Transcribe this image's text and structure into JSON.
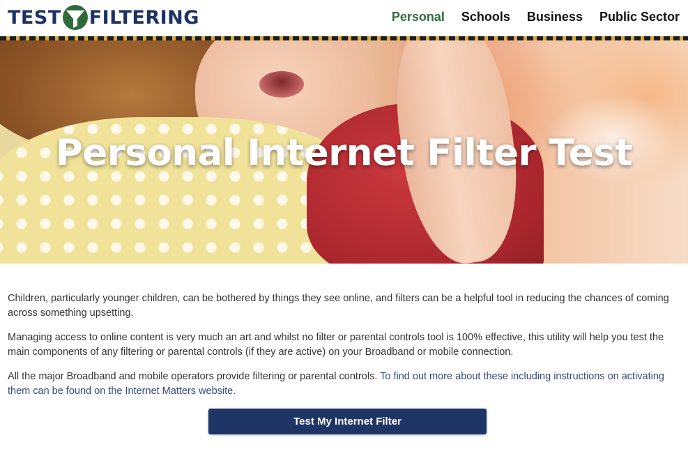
{
  "brand": {
    "logo_left": "TEST",
    "logo_right": "FILTERING",
    "logo_icon": "funnel-icon",
    "navy": "#1d3264",
    "green": "#2f6b3a"
  },
  "nav": {
    "items": [
      {
        "label": "Personal",
        "active": true
      },
      {
        "label": "Schools"
      },
      {
        "label": "Business"
      },
      {
        "label": "Public Sector"
      }
    ]
  },
  "hero": {
    "title": "Personal Internet Filter Test"
  },
  "content": {
    "p1": "Children, particularly younger children, can be bothered by things they see online, and filters can be a helpful tool in reducing the chances of coming across something upsetting.",
    "p2": "Managing access to online content is very much an art and whilst no filter or parental controls tool is 100% effective, this utility will help you test the main components of any filtering or parental controls (if they are active) on your Broadband or mobile connection.",
    "p3_text": "All the major Broadband and mobile operators provide filtering or parental controls. ",
    "p3_link": "To find out more about these including instructions on activating them can be found on the Internet Matters website."
  },
  "cta": {
    "label": "Test My Internet Filter",
    "color": "#1f3566"
  }
}
